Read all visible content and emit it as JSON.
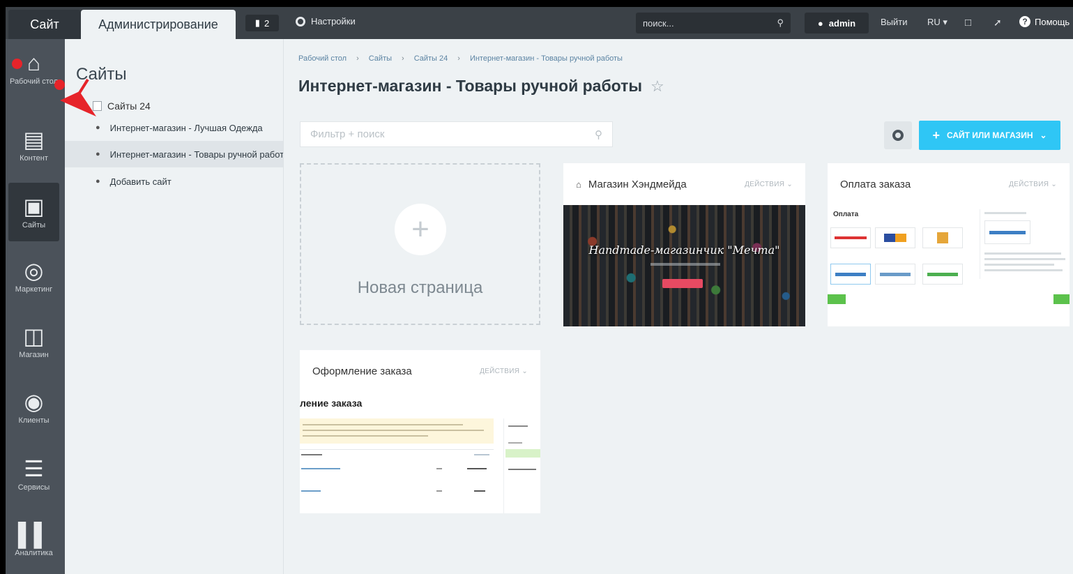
{
  "topbar": {
    "tab_site": "Сайт",
    "tab_admin": "Администрирование",
    "notifications_count": "2",
    "settings_label": "Настройки",
    "search_placeholder": "поиск...",
    "user_name": "admin",
    "logout_label": "Выйти",
    "language": "RU",
    "help_label": "Помощь"
  },
  "left_menu": {
    "items": [
      {
        "label": "Рабочий стол",
        "icon": "home-icon"
      },
      {
        "label": "Контент",
        "icon": "document-icon"
      },
      {
        "label": "Сайты",
        "icon": "sites-icon"
      },
      {
        "label": "Маркетинг",
        "icon": "target-icon"
      },
      {
        "label": "Магазин",
        "icon": "basket-icon"
      },
      {
        "label": "Клиенты",
        "icon": "clients-icon"
      },
      {
        "label": "Сервисы",
        "icon": "layers-icon"
      },
      {
        "label": "Аналитика",
        "icon": "bar-chart-icon"
      }
    ],
    "active_index": 2
  },
  "sidebar": {
    "title": "Сайты",
    "root": "Сайты 24",
    "items": [
      {
        "label": "Интернет-магазин - Лучшая Одежда"
      },
      {
        "label": "Интернет-магазин - Товары ручной работы"
      },
      {
        "label": "Добавить сайт"
      }
    ],
    "selected_index": 1
  },
  "main": {
    "breadcrumbs": [
      "Рабочий стол",
      "Сайты",
      "Сайты 24",
      "Интернет-магазин - Товары ручной работы"
    ],
    "title": "Интернет-магазин - Товары ручной работы",
    "filter_placeholder": "Фильтр + поиск",
    "add_button": "САЙТ ИЛИ МАГАЗИН",
    "new_page_label": "Новая страница",
    "cards": [
      {
        "title": "Магазин Хэндмейда",
        "actions": "ДЕЙСТВИЯ",
        "preview_heading": "Handmade-магазинчик \"Мечта\""
      },
      {
        "title": "Оплата заказа",
        "actions": "ДЕЙСТВИЯ",
        "preview_heading": "Оплата"
      },
      {
        "title": "Оформление заказа",
        "actions": "ДЕЙСТВИЯ",
        "preview_heading": "ление заказа"
      }
    ]
  },
  "colors": {
    "topbar": "#3b4147",
    "left_menu": "#4b525a",
    "accent_button": "#2fc6f5",
    "annotation_red": "#e6242a"
  }
}
